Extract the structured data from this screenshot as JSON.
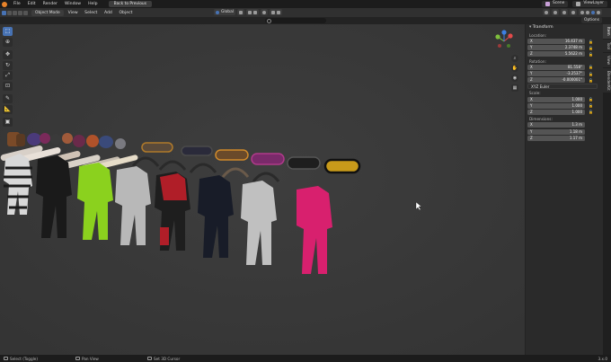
{
  "topbar": {
    "menus": [
      "File",
      "Edit",
      "Render",
      "Window",
      "Help"
    ],
    "back_button": "Back to Previous",
    "scene": "Scene",
    "view_layer": "ViewLayer"
  },
  "header": {
    "mode": "Object Mode",
    "menus": [
      "View",
      "Select",
      "Add",
      "Object"
    ],
    "transform_orientation": "Global",
    "options": "Options"
  },
  "search": {
    "placeholder": ""
  },
  "toolbar": {
    "tools": [
      {
        "name": "select-box",
        "glyph": "⬚"
      },
      {
        "name": "cursor",
        "glyph": "⊕"
      },
      {
        "name": "move",
        "glyph": "✥"
      },
      {
        "name": "rotate",
        "glyph": "↻"
      },
      {
        "name": "scale",
        "glyph": "⤢"
      },
      {
        "name": "transform",
        "glyph": "⊡"
      },
      {
        "name": "annotate",
        "glyph": "✎"
      },
      {
        "name": "measure",
        "glyph": "📐"
      },
      {
        "name": "add-cube",
        "glyph": "▣"
      }
    ]
  },
  "npanel": {
    "section": "Transform",
    "location_label": "Location:",
    "location": [
      {
        "axis": "X",
        "value": "16.437 m"
      },
      {
        "axis": "Y",
        "value": "2.3748 m"
      },
      {
        "axis": "Z",
        "value": "5.5622 m"
      }
    ],
    "rotation_label": "Rotation:",
    "rotation": [
      {
        "axis": "X",
        "value": "81.558°"
      },
      {
        "axis": "Y",
        "value": "-3.2537°"
      },
      {
        "axis": "Z",
        "value": "-0.000001°"
      }
    ],
    "rotation_mode": "XYZ Euler",
    "scale_label": "Scale:",
    "scale": [
      {
        "axis": "X",
        "value": "1.000"
      },
      {
        "axis": "Y",
        "value": "1.000"
      },
      {
        "axis": "Z",
        "value": "1.000"
      }
    ],
    "dimensions_label": "Dimensions:",
    "dimensions": [
      {
        "axis": "X",
        "value": "1.3 m"
      },
      {
        "axis": "Y",
        "value": "1.18 m"
      },
      {
        "axis": "Z",
        "value": "1.17 m"
      }
    ]
  },
  "sidetabs": [
    "Item",
    "Tool",
    "View",
    "BlenderKit"
  ],
  "status": {
    "items": [
      "Select (Toggle)",
      "Pan View",
      "Set 3D Cursor"
    ],
    "version": "3.x.0"
  },
  "colors": {
    "accent": "#4772b3",
    "viewport": "#393939",
    "axis_x": "#e34a4a",
    "axis_y": "#7fbf3d",
    "axis_z": "#3d7fe3"
  }
}
